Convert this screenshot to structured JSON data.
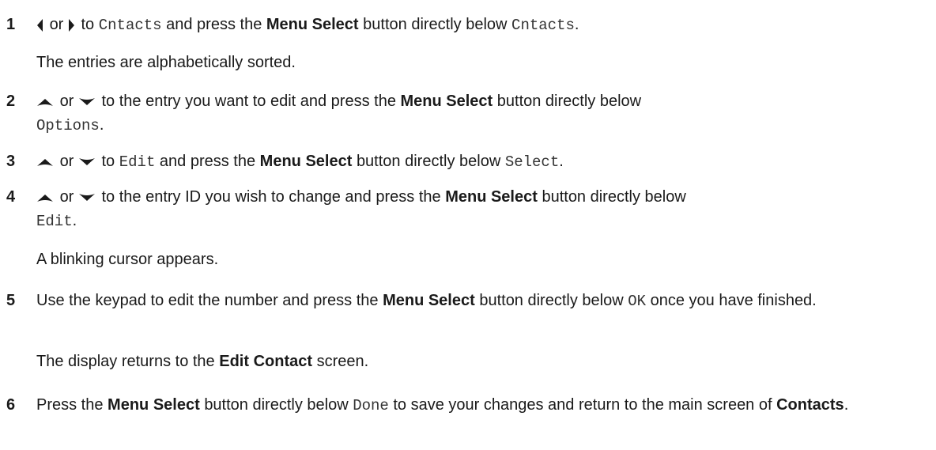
{
  "steps": [
    {
      "num": "1",
      "a": "or",
      "b": "to",
      "c": "Cntacts",
      "d": "and press the",
      "e": "Menu Select",
      "f": "button directly below",
      "g": "Cntacts",
      "h": ".",
      "note": "The entries are alphabetically sorted."
    },
    {
      "num": "2",
      "a": "or",
      "b": "to the entry you want to edit and press the",
      "c": "Menu Select",
      "d": "button directly below",
      "e": "Options",
      "f": "."
    },
    {
      "num": "3",
      "a": "or",
      "b": "to",
      "c": "Edit",
      "d": "and press the",
      "e": "Menu Select",
      "f": "button directly below",
      "g": "Select",
      "h": "."
    },
    {
      "num": "4",
      "a": "or",
      "b": "to the entry ID you wish to change and press the",
      "c": "Menu Select",
      "d": "button directly below",
      "e": "Edit",
      "f": ".",
      "note": "A blinking cursor appears."
    },
    {
      "num": "5",
      "a": "Use the keypad to edit the number and press the",
      "b": "Menu Select",
      "c": "button directly below",
      "d": "OK",
      "e": "once you have finished.",
      "note_a": "The display returns to the",
      "note_b": "Edit Contact",
      "note_c": "screen."
    },
    {
      "num": "6",
      "a": "Press the",
      "b": "Menu Select",
      "c": "button directly below",
      "d": "Done",
      "e": "to save your changes and return to the main screen of",
      "f": "Contacts",
      "g": "."
    }
  ],
  "icons": {
    "left": "left-arrow-icon",
    "right": "right-arrow-icon",
    "up": "up-arrow-icon",
    "down": "down-arrow-icon"
  }
}
